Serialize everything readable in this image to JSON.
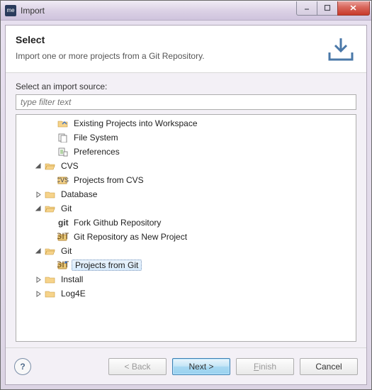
{
  "window": {
    "title": "Import",
    "app_icon_text": "me"
  },
  "header": {
    "title": "Select",
    "description": "Import one or more projects from a Git Repository."
  },
  "filter": {
    "label": "Select an import source:",
    "placeholder": "type filter text"
  },
  "tree": {
    "rows": [
      {
        "depth": 2,
        "expander": "none",
        "icon": "projects",
        "label": "Existing Projects into Workspace",
        "selected": false
      },
      {
        "depth": 2,
        "expander": "none",
        "icon": "filesys",
        "label": "File System",
        "selected": false
      },
      {
        "depth": 2,
        "expander": "none",
        "icon": "prefs",
        "label": "Preferences",
        "selected": false
      },
      {
        "depth": 1,
        "expander": "open",
        "icon": "folder-open",
        "label": "CVS",
        "selected": false
      },
      {
        "depth": 2,
        "expander": "none",
        "icon": "cvs",
        "label": "Projects from CVS",
        "selected": false
      },
      {
        "depth": 1,
        "expander": "closed",
        "icon": "folder",
        "label": "Database",
        "selected": false
      },
      {
        "depth": 1,
        "expander": "open",
        "icon": "folder-open",
        "label": "Git",
        "selected": false
      },
      {
        "depth": 2,
        "expander": "none",
        "icon": "git-text",
        "label": "Fork Github Repository",
        "selected": false
      },
      {
        "depth": 2,
        "expander": "none",
        "icon": "git-repo",
        "label": "Git Repository as New Project",
        "selected": false
      },
      {
        "depth": 1,
        "expander": "open",
        "icon": "folder-open",
        "label": "Git",
        "selected": false
      },
      {
        "depth": 2,
        "expander": "none",
        "icon": "git-proj",
        "label": "Projects from Git",
        "selected": true
      },
      {
        "depth": 1,
        "expander": "closed",
        "icon": "folder",
        "label": "Install",
        "selected": false
      },
      {
        "depth": 1,
        "expander": "closed",
        "icon": "folder",
        "label": "Log4E",
        "selected": false
      }
    ]
  },
  "buttons": {
    "back": "< Back",
    "next": "Next >",
    "finish": "Finish",
    "cancel": "Cancel"
  }
}
